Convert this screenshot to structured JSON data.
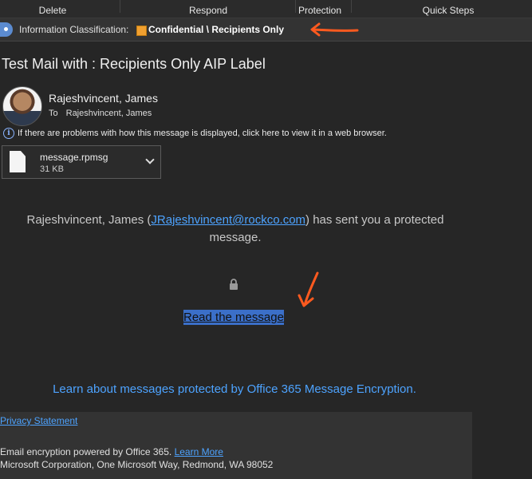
{
  "ribbon": {
    "groups": [
      "Delete",
      "Respond",
      "Protection",
      "Quick Steps"
    ]
  },
  "classification": {
    "label": "Information Classification:",
    "value": "Confidential \\ Recipients Only",
    "swatch_color": "#f0a030"
  },
  "message": {
    "subject": "Test Mail with : Recipients Only AIP Label",
    "sender": "Rajeshvincent, James",
    "to_label": "To",
    "to_value": "Rajeshvincent, James",
    "info_bar": "If there are problems with how this message is displayed, click here to view it in a web browser.",
    "attachment": {
      "name": "message.rpmsg",
      "size": "31 KB"
    }
  },
  "body": {
    "sender_name": "Rajeshvincent, James",
    "open_paren": "(",
    "sender_email": "JRajeshvincent@rockco.com",
    "suffix": ") has sent you a protected message.",
    "read_link": "Read the message",
    "learn_link": "Learn about messages protected by Office 365 Message Encryption."
  },
  "footer": {
    "privacy": "Privacy Statement",
    "powered": "Email encryption powered by Office 365.",
    "learn_more": "Learn More",
    "address": "Microsoft Corporation, One Microsoft Way, Redmond, WA 98052"
  },
  "colors": {
    "accent_link": "#4da3ff",
    "annotation": "#ff5a1f",
    "background": "#262626"
  },
  "icons": [
    "sensitivity-tag-icon",
    "info-icon",
    "file-icon",
    "chevron-down-icon",
    "lock-icon"
  ]
}
